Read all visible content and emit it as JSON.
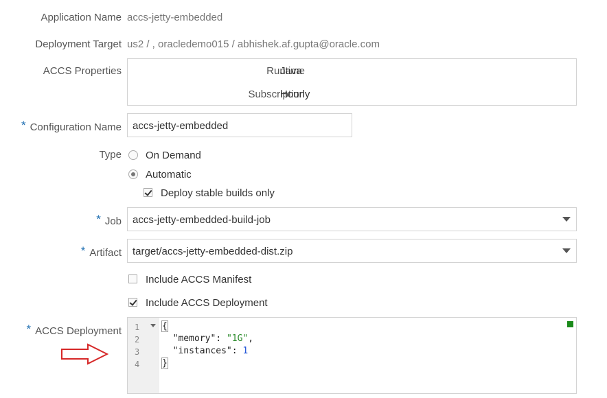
{
  "fields": {
    "application_name": {
      "label": "Application Name",
      "value": "accs-jetty-embedded"
    },
    "deployment_target": {
      "label": "Deployment Target",
      "value": "us2 / ,  oracledemo015 / abhishek.af.gupta@oracle.com"
    },
    "accs_properties": {
      "label": "ACCS Properties",
      "runtime_label": "Runtime",
      "runtime_value": "Java",
      "subscription_label": "Subscription",
      "subscription_value": "Hourly"
    },
    "configuration_name": {
      "label": "Configuration Name",
      "value": "accs-jetty-embedded",
      "required": "*"
    },
    "type": {
      "label": "Type",
      "options": [
        "On Demand",
        "Automatic"
      ],
      "selected": "Automatic"
    },
    "deploy_stable": {
      "label": "Deploy stable builds only",
      "checked": true
    },
    "job": {
      "label": "Job",
      "value": "accs-jetty-embedded-build-job",
      "required": "*"
    },
    "artifact": {
      "label": "Artifact",
      "value": "target/accs-jetty-embedded-dist.zip",
      "required": "*"
    },
    "include_manifest": {
      "label": "Include ACCS Manifest",
      "checked": false
    },
    "include_deployment": {
      "label": "Include ACCS Deployment",
      "checked": true
    },
    "accs_deployment": {
      "label": "ACCS Deployment",
      "required": "*",
      "line_numbers": [
        "1",
        "2",
        "3",
        "4"
      ],
      "line1": "{",
      "line2_key": "\"memory\"",
      "line2_sep": ": ",
      "line2_val": "\"1G\"",
      "line2_end": ",",
      "line3_key": "\"instances\"",
      "line3_sep": ": ",
      "line3_val": "1",
      "line4": "}"
    }
  },
  "colors": {
    "required_star": "#1f6fb2",
    "arrow": "#d62828",
    "status_square": "#1a8a1a"
  },
  "icons": [
    "red-arrow-icon",
    "dropdown-arrow-icon",
    "fold-arrow-icon"
  ]
}
